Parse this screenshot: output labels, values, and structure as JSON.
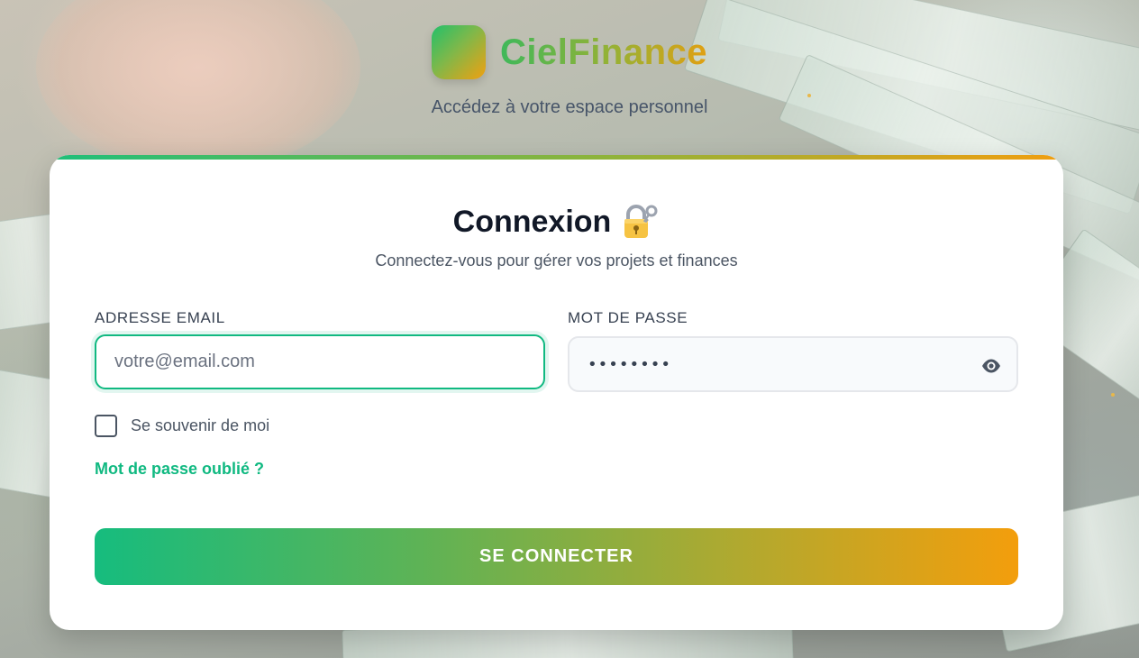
{
  "brand": {
    "name": "CielFinance",
    "tagline": "Accédez à votre espace personnel"
  },
  "login": {
    "title": "Connexion",
    "title_icon": "lock-with-key-icon",
    "subtitle": "Connectez-vous pour gérer vos projets et finances",
    "email_label": "ADRESSE EMAIL",
    "email_placeholder": "votre@email.com",
    "email_value": "",
    "password_label": "MOT DE PASSE",
    "password_value": "••••••••",
    "password_toggle_icon": "eye-icon",
    "remember_label": "Se souvenir de moi",
    "remember_checked": false,
    "forgot_link": "Mot de passe oublié ?",
    "submit_label": "SE CONNECTER"
  },
  "colors": {
    "accent_green": "#10b981",
    "accent_orange": "#f39e0c",
    "title_text": "#111827"
  }
}
